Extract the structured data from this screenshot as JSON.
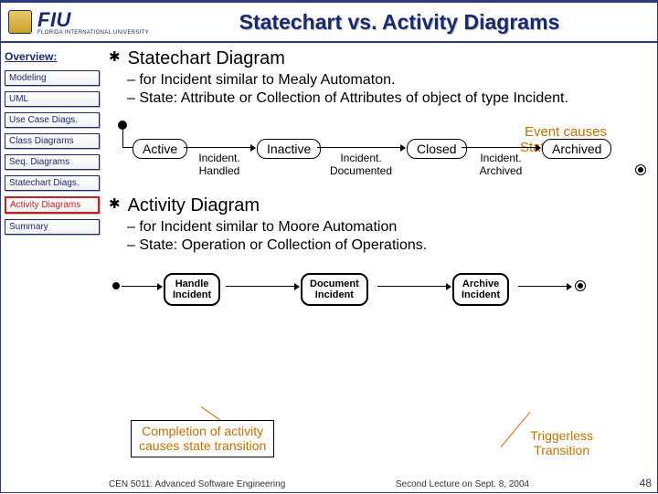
{
  "header": {
    "brand": "FIU",
    "brand_sub": "FLORIDA INTERNATIONAL UNIVERSITY",
    "title": "Statechart vs. Activity Diagrams"
  },
  "sidebar": {
    "heading": "Overview:",
    "items": [
      {
        "label": "Modeling",
        "active": false
      },
      {
        "label": "UML",
        "active": false
      },
      {
        "label": "Use Case Diags.",
        "active": false
      },
      {
        "label": "Class Diagrams",
        "active": false
      },
      {
        "label": "Seq. Diagrams",
        "active": false
      },
      {
        "label": "Statechart Diags.",
        "active": false
      },
      {
        "label": "Activity Diagrams",
        "active": true
      },
      {
        "label": "Summary",
        "active": false
      }
    ]
  },
  "content": {
    "section1": {
      "title": "Statechart Diagram",
      "sub1": "– for Incident similar to Mealy Automaton.",
      "sub2": "– State: Attribute or Collection of Attributes of object of type Incident."
    },
    "callout_event_l1": "Event causes",
    "callout_event_l2": "State transition",
    "statechart": {
      "n1": "Active",
      "n2": "Inactive",
      "n3": "Closed",
      "n4": "Archived",
      "e1": "Incident.\nHandled",
      "e2": "Incident.\nDocumented",
      "e3": "Incident.\nArchived"
    },
    "section2": {
      "title": "Activity Diagram",
      "sub1": "– for Incident similar to Moore Automation",
      "sub2": "– State: Operation or Collection of Operations."
    },
    "activity": {
      "b1": "Handle\nIncident",
      "b2": "Document\nIncident",
      "b3": "Archive\nIncident"
    },
    "callout_completion_l1": "Completion of activity",
    "callout_completion_l2": "causes state transition",
    "callout_trigger_l1": "Triggerless",
    "callout_trigger_l2": "Transition"
  },
  "footer": {
    "left": "CEN 5011: Advanced Software Engineering",
    "right": "Second Lecture on Sept. 8, 2004",
    "slide": "48"
  }
}
